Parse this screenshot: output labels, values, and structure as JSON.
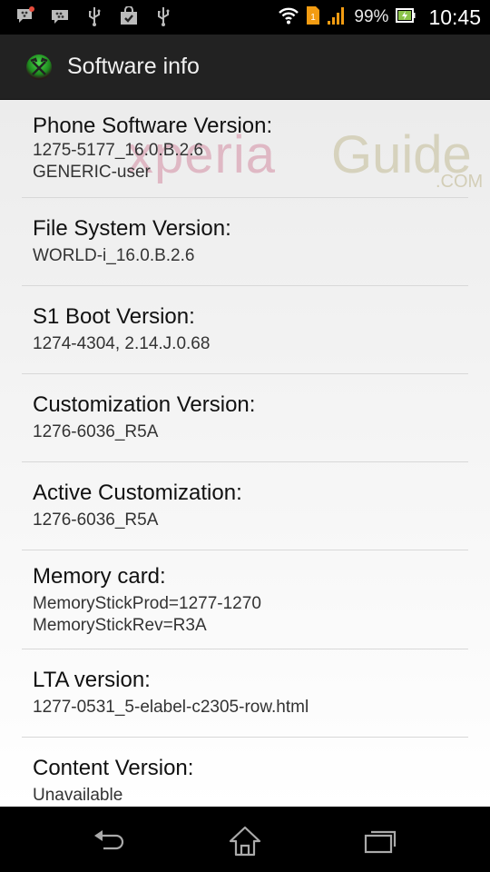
{
  "status_bar": {
    "notification_icons": [
      "bbm-message-icon",
      "bbm-icon",
      "usb-icon",
      "shopping-bag-check-icon",
      "usb-debug-icon"
    ],
    "sim_label": "1",
    "battery_percent": "99%",
    "time": "10:45",
    "colors": {
      "signal": "#f39c12",
      "battery_fill": "#8bc34a"
    }
  },
  "action_bar": {
    "title": "Software info",
    "icon": "app-icon"
  },
  "watermark": {
    "brand_part1": "xperia",
    "brand_part2": "Guide",
    "suffix": ".COM"
  },
  "items": [
    {
      "label": "Phone Software Version:",
      "value": "1275-5177_16.0.B.2.6\nGENERIC-user"
    },
    {
      "label": "File System Version:",
      "value": "WORLD-i_16.0.B.2.6"
    },
    {
      "label": "S1 Boot Version:",
      "value": "1274-4304, 2.14.J.0.68"
    },
    {
      "label": "Customization Version:",
      "value": "1276-6036_R5A"
    },
    {
      "label": "Active Customization:",
      "value": "1276-6036_R5A"
    },
    {
      "label": "Memory card:",
      "value": "MemoryStickProd=1277-1270\nMemoryStickRev=R3A"
    },
    {
      "label": "LTA version:",
      "value": "1277-0531_5-elabel-c2305-row.html"
    },
    {
      "label": "Content Version:",
      "value": "Unavailable"
    }
  ],
  "nav_bar": {
    "back": "back-icon",
    "home": "home-icon",
    "recents": "recents-icon"
  }
}
